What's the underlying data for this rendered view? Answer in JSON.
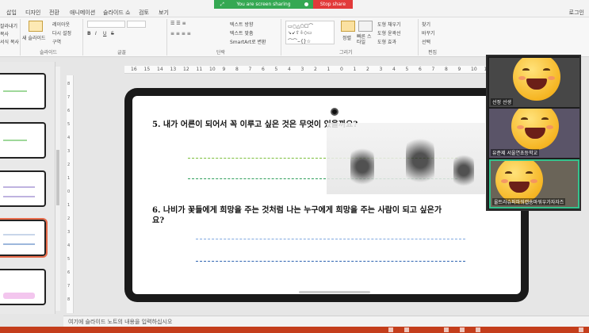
{
  "tabs": [
    "삽입",
    "디자인",
    "전환",
    "애니메이션",
    "슬라이드 쇼",
    "검토",
    "보기"
  ],
  "login": "로그인",
  "share": {
    "status": "You are screen sharing",
    "stop": "Stop share"
  },
  "ribbon": {
    "clipboard": [
      "잘라내기",
      "복사",
      "서식 복사"
    ],
    "new_slide": "새 슬라이드",
    "slide_items": [
      "레이아웃",
      "다시 설정",
      "구역"
    ],
    "shape_commands": [
      "텍스트 방향",
      "텍스트 맞춤",
      "SmartArt로 변환"
    ],
    "arrange": "정렬",
    "quick_styles": "빠른 스타일",
    "shape_format": [
      "도형 채우기",
      "도형 윤곽선",
      "도형 효과"
    ],
    "editing": [
      "찾기",
      "바꾸기",
      "선택"
    ],
    "group_labels": {
      "slides": "슬라이드",
      "font": "글꼴",
      "paragraph": "단락",
      "drawing": "그리기",
      "editing": "편집"
    }
  },
  "ruler_ticks": [
    "16",
    "15",
    "14",
    "13",
    "12",
    "11",
    "10",
    "9",
    "8",
    "7",
    "6",
    "5",
    "4",
    "3",
    "2",
    "1",
    "0",
    "1",
    "2",
    "3",
    "4",
    "5",
    "6",
    "7",
    "8",
    "9",
    "10",
    "11"
  ],
  "vruler_ticks": [
    "8",
    "7",
    "6",
    "5",
    "4",
    "3",
    "2",
    "1",
    "0",
    "1",
    "2",
    "3",
    "4",
    "5",
    "6",
    "7",
    "8"
  ],
  "slide": {
    "q5": "5. 내가 어른이 되어서 꼭 이루고 싶은 것은 무엇이 있을까요?",
    "q6_line1": "6. 나비가 꽃들에게 희망을 주는 것처럼 나는 누구에게 희망을 주는 사람이 되고 싶은가",
    "q6_line2": "요?"
  },
  "participants": [
    {
      "name": "선정 선생"
    },
    {
      "name": "유준제 서울연초등학교"
    },
    {
      "name": "울트라슈퍼파워캡숑마워우가자자즈"
    }
  ],
  "notes_placeholder": "여기에 슬라이드 노트의 내용을 입력하십시오",
  "colors": {
    "accent": "#c43e1c",
    "share_green": "#35a853",
    "share_red": "#e23a3a",
    "q5_line": "#7bbf3a",
    "q5_line2": "#2e9e5a",
    "q6_line": "#7fa8e0",
    "q6_line2": "#2c62b0",
    "active_tile": "#34c28d"
  }
}
